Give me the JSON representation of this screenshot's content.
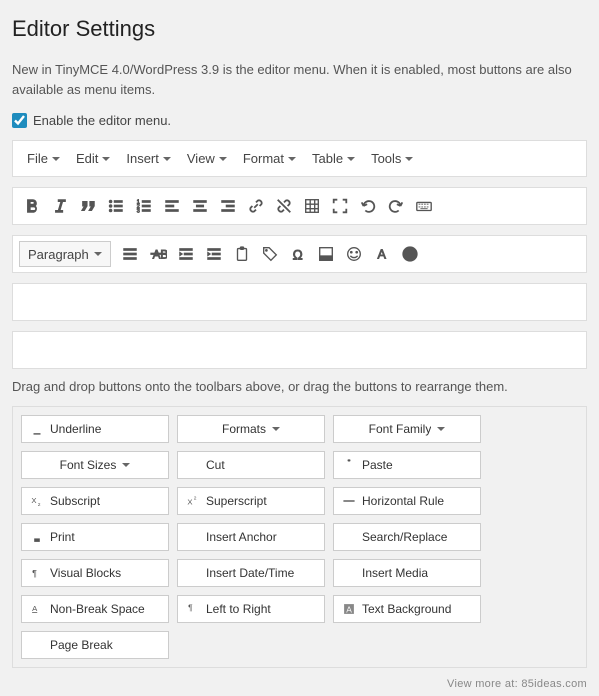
{
  "title": "Editor Settings",
  "intro": "New in TinyMCE 4.0/WordPress 3.9 is the editor menu. When it is enabled, most buttons are also available as menu items.",
  "enable_label": "Enable the editor menu.",
  "menubar": [
    "File",
    "Edit",
    "Insert",
    "View",
    "Format",
    "Table",
    "Tools"
  ],
  "paragraph_label": "Paragraph",
  "dnd_text": "Drag and drop buttons onto the toolbars above, or drag the buttons to rearrange them.",
  "row1_icons": [
    "bold",
    "italic",
    "quote",
    "ul",
    "ol",
    "align-left",
    "align-center",
    "align-right",
    "link",
    "unlink",
    "table",
    "fullscreen",
    "undo",
    "redo",
    "keyboard"
  ],
  "row2_icons": [
    "justify",
    "strike",
    "outdent",
    "indent",
    "paste",
    "tag",
    "omega",
    "color",
    "smile",
    "font",
    "help"
  ],
  "pool": [
    {
      "icon": "underline",
      "label": "Underline"
    },
    {
      "icon": "",
      "label": "Formats",
      "caret": true
    },
    {
      "icon": "",
      "label": "Font Family",
      "caret": true
    },
    {
      "icon": "",
      "label": "Font Sizes",
      "caret": true
    },
    {
      "icon": "cut",
      "label": "Cut"
    },
    {
      "icon": "paste",
      "label": "Paste"
    },
    {
      "icon": "subscript",
      "label": "Subscript"
    },
    {
      "icon": "superscript",
      "label": "Superscript"
    },
    {
      "icon": "hr",
      "label": "Horizontal Rule"
    },
    {
      "icon": "print",
      "label": "Print"
    },
    {
      "icon": "anchor",
      "label": "Insert Anchor"
    },
    {
      "icon": "search",
      "label": "Search/Replace"
    },
    {
      "icon": "blocks",
      "label": "Visual Blocks"
    },
    {
      "icon": "clock",
      "label": "Insert Date/Time"
    },
    {
      "icon": "media",
      "label": "Insert Media"
    },
    {
      "icon": "nbsp",
      "label": "Non-Break Space"
    },
    {
      "icon": "ltr",
      "label": "Left to Right"
    },
    {
      "icon": "textbg",
      "label": "Text Background"
    },
    {
      "icon": "pagebreak",
      "label": "Page Break"
    }
  ],
  "footer": "View more at: 85ideas.com"
}
